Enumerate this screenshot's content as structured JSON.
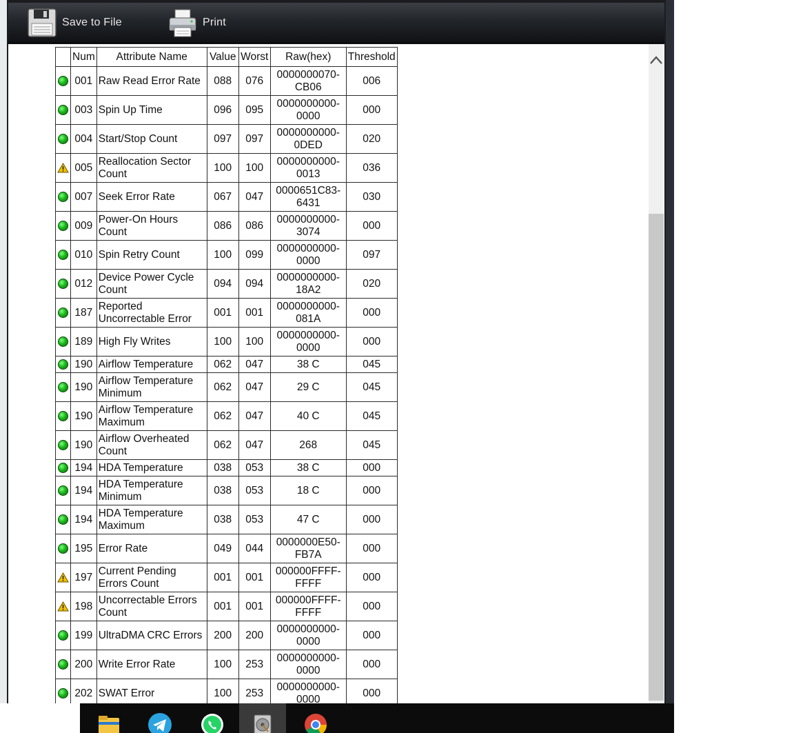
{
  "toolbar": {
    "save_label": "Save to File",
    "print_label": "Print"
  },
  "table": {
    "headers": [
      "",
      "Num",
      "Attribute Name",
      "Value",
      "Worst",
      "Raw(hex)",
      "Threshold"
    ],
    "rows": [
      {
        "status": "ok",
        "num": "001",
        "name": "Raw Read Error Rate",
        "value": "088",
        "worst": "076",
        "raw": "0000000070-\nCB06",
        "threshold": "006"
      },
      {
        "status": "ok",
        "num": "003",
        "name": "Spin Up Time",
        "value": "096",
        "worst": "095",
        "raw": "0000000000-\n0000",
        "threshold": "000"
      },
      {
        "status": "ok",
        "num": "004",
        "name": "Start/Stop Count",
        "value": "097",
        "worst": "097",
        "raw": "0000000000-\n0DED",
        "threshold": "020"
      },
      {
        "status": "warn",
        "num": "005",
        "name": "Reallocation Sector\nCount",
        "value": "100",
        "worst": "100",
        "raw": "0000000000-\n0013",
        "threshold": "036"
      },
      {
        "status": "ok",
        "num": "007",
        "name": "Seek Error Rate",
        "value": "067",
        "worst": "047",
        "raw": "0000651C83-\n6431",
        "threshold": "030"
      },
      {
        "status": "ok",
        "num": "009",
        "name": "Power-On Hours\nCount",
        "value": "086",
        "worst": "086",
        "raw": "0000000000-\n3074",
        "threshold": "000"
      },
      {
        "status": "ok",
        "num": "010",
        "name": "Spin Retry Count",
        "value": "100",
        "worst": "099",
        "raw": "0000000000-\n0000",
        "threshold": "097"
      },
      {
        "status": "ok",
        "num": "012",
        "name": "Device Power Cycle\nCount",
        "value": "094",
        "worst": "094",
        "raw": "0000000000-\n18A2",
        "threshold": "020"
      },
      {
        "status": "ok",
        "num": "187",
        "name": "Reported\nUncorrectable Error",
        "value": "001",
        "worst": "001",
        "raw": "0000000000-\n081A",
        "threshold": "000"
      },
      {
        "status": "ok",
        "num": "189",
        "name": "High Fly Writes",
        "value": "100",
        "worst": "100",
        "raw": "0000000000-\n0000",
        "threshold": "000"
      },
      {
        "status": "ok",
        "num": "190",
        "name": "Airflow Temperature",
        "value": "062",
        "worst": "047",
        "raw": "38 C",
        "threshold": "045"
      },
      {
        "status": "ok",
        "num": "190",
        "name": "Airflow Temperature\nMinimum",
        "value": "062",
        "worst": "047",
        "raw": "29 C",
        "threshold": "045"
      },
      {
        "status": "ok",
        "num": "190",
        "name": "Airflow Temperature\nMaximum",
        "value": "062",
        "worst": "047",
        "raw": "40 C",
        "threshold": "045"
      },
      {
        "status": "ok",
        "num": "190",
        "name": "Airflow Overheated\nCount",
        "value": "062",
        "worst": "047",
        "raw": "268",
        "threshold": "045"
      },
      {
        "status": "ok",
        "num": "194",
        "name": "HDA Temperature",
        "value": "038",
        "worst": "053",
        "raw": "38 C",
        "threshold": "000"
      },
      {
        "status": "ok",
        "num": "194",
        "name": "HDA Temperature\nMinimum",
        "value": "038",
        "worst": "053",
        "raw": "18 C",
        "threshold": "000"
      },
      {
        "status": "ok",
        "num": "194",
        "name": "HDA Temperature\nMaximum",
        "value": "038",
        "worst": "053",
        "raw": "47 C",
        "threshold": "000"
      },
      {
        "status": "ok",
        "num": "195",
        "name": "Error Rate",
        "value": "049",
        "worst": "044",
        "raw": "0000000E50-\nFB7A",
        "threshold": "000"
      },
      {
        "status": "warn",
        "num": "197",
        "name": "Current Pending\nErrors Count",
        "value": "001",
        "worst": "001",
        "raw": "000000FFFF-\nFFFF",
        "threshold": "000"
      },
      {
        "status": "warn",
        "num": "198",
        "name": "Uncorrectable Errors\nCount",
        "value": "001",
        "worst": "001",
        "raw": "000000FFFF-\nFFFF",
        "threshold": "000"
      },
      {
        "status": "ok",
        "num": "199",
        "name": "UltraDMA CRC Errors",
        "value": "200",
        "worst": "200",
        "raw": "0000000000-\n0000",
        "threshold": "000"
      },
      {
        "status": "ok",
        "num": "200",
        "name": "Write Error Rate",
        "value": "100",
        "worst": "253",
        "raw": "0000000000-\n0000",
        "threshold": "000"
      },
      {
        "status": "ok",
        "num": "202",
        "name": "SWAT Error",
        "value": "100",
        "worst": "253",
        "raw": "0000000000-\n0000",
        "threshold": "000"
      }
    ]
  },
  "taskbar": {
    "items": [
      {
        "icon": "file-explorer-icon",
        "color": "#f4c542"
      },
      {
        "icon": "telegram-icon",
        "color": "#2aa3e0"
      },
      {
        "icon": "whatsapp-icon",
        "color": "#25d366"
      },
      {
        "icon": "hard-disk-app-icon",
        "color": "#8a8a8a"
      },
      {
        "icon": "chrome-icon",
        "color": "#4285f4"
      }
    ]
  },
  "colors": {
    "status_ok": "#19b819",
    "status_warn": "#f2c200",
    "toolbar_bg": "#22252a"
  }
}
